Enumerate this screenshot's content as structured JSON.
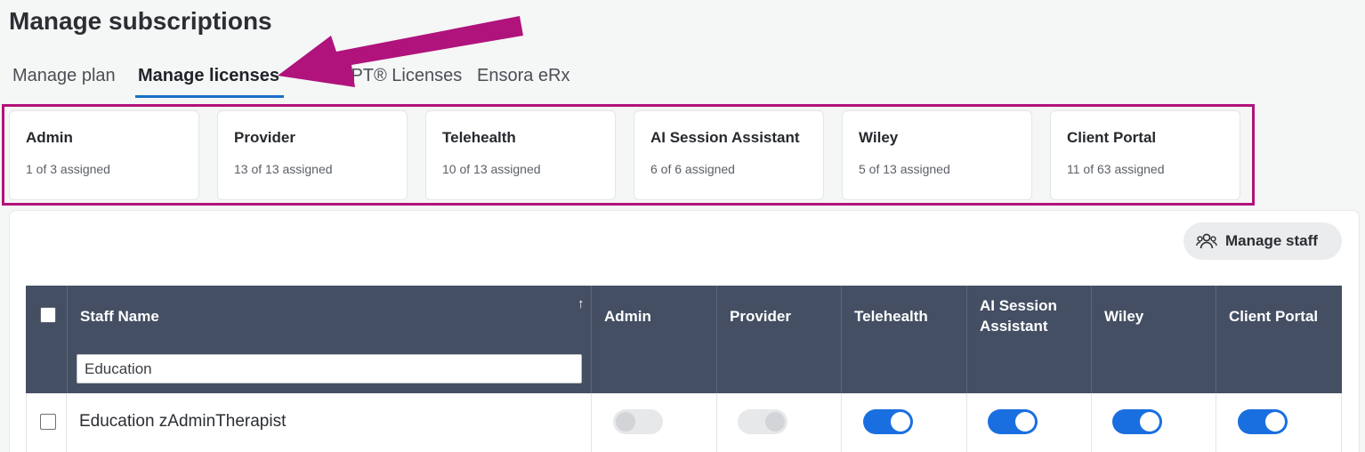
{
  "page": {
    "title": "Manage subscriptions"
  },
  "tabs": [
    {
      "label": "Manage plan",
      "active": false
    },
    {
      "label": "Manage licenses",
      "active": true
    },
    {
      "label": "CPT® Licenses",
      "active": false
    },
    {
      "label": "Ensora eRx",
      "active": false
    }
  ],
  "license_cards": [
    {
      "name": "Admin",
      "assigned": "1 of 3 assigned"
    },
    {
      "name": "Provider",
      "assigned": "13 of 13 assigned"
    },
    {
      "name": "Telehealth",
      "assigned": "10 of 13 assigned"
    },
    {
      "name": "AI Session Assistant",
      "assigned": "6 of 6 assigned"
    },
    {
      "name": "Wiley",
      "assigned": "5 of 13 assigned"
    },
    {
      "name": "Client Portal",
      "assigned": "11 of 63 assigned"
    }
  ],
  "toolbar": {
    "manage_staff_label": "Manage staff",
    "manage_staff_icon": "people-icon"
  },
  "table": {
    "columns": [
      "Staff Name",
      "Admin",
      "Provider",
      "Telehealth",
      "AI Session Assistant",
      "Wiley",
      "Client Portal"
    ],
    "column_labels": {
      "staff_name": "Staff Name",
      "admin": "Admin",
      "provider": "Provider",
      "telehealth": "Telehealth",
      "ai_session_line1": "AI Session",
      "ai_session_line2": "Assistant",
      "wiley": "Wiley",
      "client_portal": "Client Portal"
    },
    "sort_icon": "arrow-up-icon",
    "filter_value": "Education",
    "rows": [
      {
        "name": "Education zAdminTherapist",
        "checked": false,
        "admin": false,
        "provider": false,
        "telehealth": true,
        "ai_session_assistant": true,
        "wiley": true,
        "client_portal": true
      }
    ]
  },
  "colors": {
    "highlight": "#b2127a",
    "header_bg": "#444f63",
    "toggle_on": "#1a6fe0",
    "tab_underline": "#1a6fc9"
  }
}
